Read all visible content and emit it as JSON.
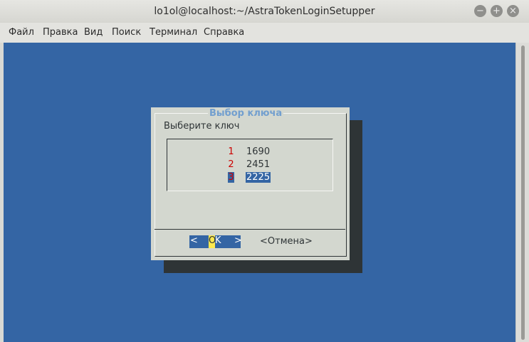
{
  "window": {
    "title": "lo1ol@localhost:~/AstraTokenLoginSetupper",
    "minimize_icon": "minimize-icon",
    "maximize_icon": "maximize-icon",
    "close_icon": "close-icon"
  },
  "menu": [
    "Файл",
    "Правка",
    "Вид",
    "Поиск",
    "Терминал",
    "Справка"
  ],
  "dialog": {
    "title": "Выбор ключа",
    "prompt": "Выберите ключ",
    "items": [
      {
        "num": "1",
        "value": "1690"
      },
      {
        "num": "2",
        "value": "2451"
      },
      {
        "num": "3",
        "value": "2225"
      }
    ],
    "selected_index": 2,
    "ok_button": {
      "left": "<",
      "hotkey": "O",
      "rest": "K",
      "right": ">"
    },
    "cancel_button": "<Отмена>"
  },
  "colors": {
    "terminal_bg": "#3465a4",
    "dialog_bg": "#d3d7cf",
    "title_color": "#729fcf",
    "number_color": "#cc0000",
    "hotkey_bg": "#fce94f"
  }
}
